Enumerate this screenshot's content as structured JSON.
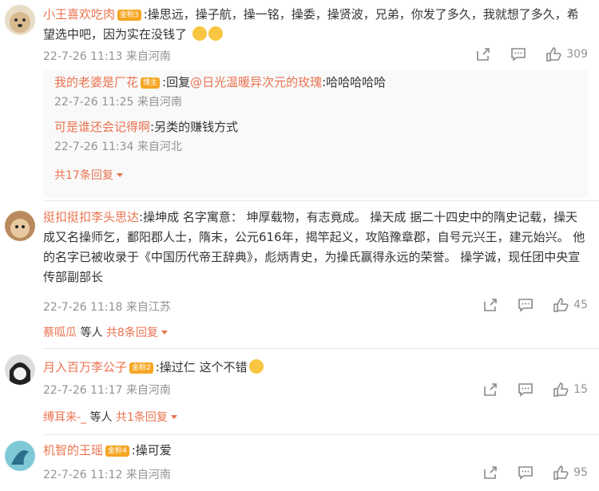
{
  "comments": [
    {
      "username": "小王喜欢吃肉",
      "badge": "金粉3",
      "text": ":操思远，操子航，操一铭，操委，操贤波，兄弟，你发了多久，我就想了多久，希望选中吧，因为实在没钱了",
      "time": "22-7-26 11:13",
      "location": "来自河南",
      "likes": "309",
      "replies": [
        {
          "username": "我的老婆是厂花",
          "badge": "博主",
          "text_prefix": ":回复",
          "mention": "@日光温暖异次元的玫瑰",
          "text": ":哈哈哈哈哈",
          "time": "22-7-26 11:25",
          "location": "来自河南"
        },
        {
          "username": "可是谁还会记得啊",
          "text": ":另类的赚钱方式",
          "time": "22-7-26 11:34",
          "location": "来自河北"
        }
      ],
      "more_replies": "共17条回复"
    },
    {
      "username": "挺扣挺扣李头思达",
      "text": ":操坤成 名字寓意： 坤厚载物，有志竟成。 操天成 据二十四史中的隋史记载，操天成又名操师乞，鄱阳郡人士，隋末，公元616年，揭竿起义，攻陷豫章郡，自号元兴王，建元始兴。 他的名字已被收录于《中国历代帝王辞典》，彪炳青史，为操氏赢得永远的荣誉。 操学诚，现任团中央宣传部副部长",
      "time": "22-7-26 11:18",
      "location": "来自江苏",
      "likes": "45",
      "reply_summary": {
        "user": "蔡呱瓜",
        "middle": "等人",
        "count": "共8条回复"
      }
    },
    {
      "username": "月入百万李公子",
      "badge": "金粉2",
      "text": ":操过仁 这个不错",
      "time": "22-7-26 11:17",
      "location": "来自河南",
      "likes": "15",
      "reply_summary": {
        "user": "缚耳来-_",
        "middle": "等人",
        "count": "共1条回复"
      }
    },
    {
      "username": "机智的王瑶",
      "badge": "金粉4",
      "text": ":操可爱",
      "time": "22-7-26 11:12",
      "location": "来自河南",
      "likes": "95"
    }
  ]
}
